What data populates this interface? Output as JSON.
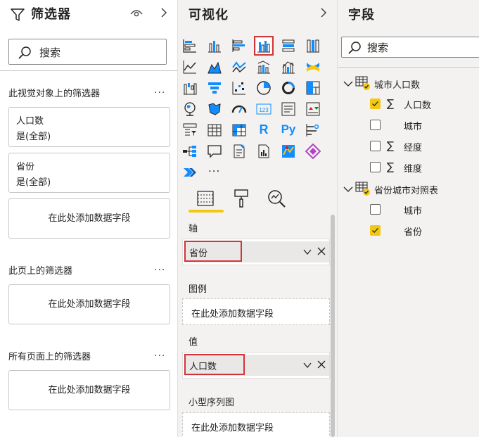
{
  "filters": {
    "title": "筛选器",
    "search_placeholder": "搜索",
    "sections": [
      {
        "label": "此视觉对象上的筛选器",
        "more": "..."
      },
      {
        "label": "此页上的筛选器",
        "more": "..."
      },
      {
        "label": "所有页面上的筛选器",
        "more": "..."
      }
    ],
    "cards": [
      {
        "field": "人口数",
        "value": "是(全部)"
      },
      {
        "field": "省份",
        "value": "是(全部)"
      }
    ],
    "add_field_label": "在此处添加数据字段"
  },
  "viz": {
    "title": "可视化",
    "more_visuals": "...",
    "wells": [
      {
        "label": "轴",
        "value": "省份"
      },
      {
        "label": "图例",
        "value": "在此处添加数据字段"
      },
      {
        "label": "值",
        "value": "人口数"
      },
      {
        "label": "小型序列图",
        "value": "在此处添加数据字段"
      }
    ],
    "r_label": "R",
    "py_label": "Py",
    "card_number": "123"
  },
  "fields": {
    "title": "字段",
    "search_placeholder": "搜索",
    "tables": [
      {
        "name": "城市人口数",
        "fields": [
          {
            "name": "人口数",
            "sigma": "∑",
            "checked": true
          },
          {
            "name": "城市",
            "sigma": "",
            "checked": false
          },
          {
            "name": "经度",
            "sigma": "∑",
            "checked": false
          },
          {
            "name": "维度",
            "sigma": "∑",
            "checked": false
          }
        ]
      },
      {
        "name": "省份城市对照表",
        "fields": [
          {
            "name": "城市",
            "sigma": "",
            "checked": false
          },
          {
            "name": "省份",
            "sigma": "",
            "checked": true
          }
        ]
      }
    ]
  },
  "colors": {
    "accent": "#f2c811",
    "highlight": "#d13438",
    "icon": "#118dff"
  }
}
